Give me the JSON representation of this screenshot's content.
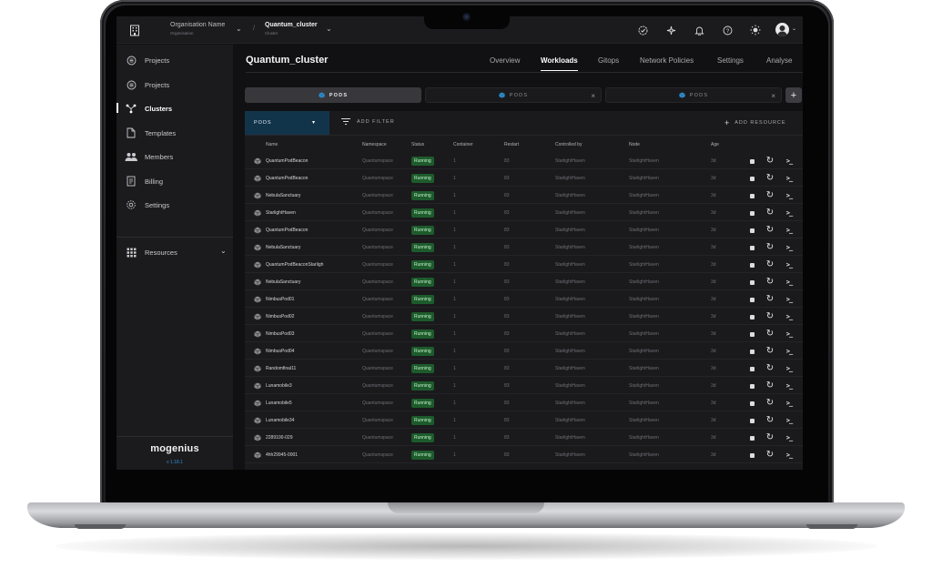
{
  "topbar": {
    "org_name": "Organisation Name",
    "org_sub": "Organisation",
    "separator": "/",
    "cluster_name": "Quantum_cluster",
    "cluster_sub": "Cluster"
  },
  "sidebar": {
    "items": [
      {
        "label": "Projects",
        "icon": "project-icon"
      },
      {
        "label": "Projects",
        "icon": "project-icon"
      },
      {
        "label": "Clusters",
        "icon": "cluster-icon",
        "active": true
      },
      {
        "label": "Templates",
        "icon": "document-icon"
      },
      {
        "label": "Members",
        "icon": "members-icon"
      },
      {
        "label": "Billing",
        "icon": "billing-icon"
      },
      {
        "label": "Settings",
        "icon": "gear-icon"
      },
      {
        "label": "Resources",
        "icon": "grid-icon"
      }
    ],
    "brand": "mogenius",
    "version": "v 1.18.1"
  },
  "main": {
    "title": "Quantum_cluster",
    "tabs": [
      "Overview",
      "Workloads",
      "Gitops",
      "Network Policies",
      "Settings",
      "Analyse"
    ],
    "active_tab": "Workloads",
    "pod_tabs": [
      "PODS",
      "PODS",
      "PODS"
    ],
    "type_select": "PODS",
    "add_filter": "ADD FILTER",
    "add_resource": "ADD RESOURCE"
  },
  "table": {
    "columns": [
      "Name",
      "Namespace",
      "Status",
      "Container",
      "Restart",
      "Controlled by",
      "Node",
      "Age"
    ],
    "rows": [
      [
        "QuantumPodBeacon",
        "Quantumspace",
        "Running",
        "1",
        "83",
        "StarlightHaven",
        "StarlightHaven",
        "3d"
      ],
      [
        "QuantumPodBeacon",
        "Quantumspace",
        "Running",
        "1",
        "83",
        "StarlightHaven",
        "StarlightHaven",
        "3d"
      ],
      [
        "NebulaSanctuary",
        "Quantumspace",
        "Running",
        "1",
        "83",
        "StarlightHaven",
        "StarlightHaven",
        "3d"
      ],
      [
        "StarlightHaven",
        "Quantumspace",
        "Running",
        "1",
        "83",
        "StarlightHaven",
        "StarlightHaven",
        "3d"
      ],
      [
        "QuantumPodBeacon",
        "Quantumspace",
        "Running",
        "1",
        "83",
        "StarlightHaven",
        "StarlightHaven",
        "3d"
      ],
      [
        "NebulaSanctuary",
        "Quantumspace",
        "Running",
        "1",
        "83",
        "StarlightHaven",
        "StarlightHaven",
        "3d"
      ],
      [
        "QuantumPodBeaconStarligh",
        "Quantumspace",
        "Running",
        "1",
        "83",
        "StarlightHaven",
        "StarlightHaven",
        "3d"
      ],
      [
        "NebulaSanctuary",
        "Quantumspace",
        "Running",
        "1",
        "83",
        "StarlightHaven",
        "StarlightHaven",
        "3d"
      ],
      [
        "NimbusPod01",
        "Quantumspace",
        "Running",
        "1",
        "83",
        "StarlightHaven",
        "StarlightHaven",
        "3d"
      ],
      [
        "NimbusPod02",
        "Quantumspace",
        "Running",
        "1",
        "83",
        "StarlightHaven",
        "StarlightHaven",
        "3d"
      ],
      [
        "NimbusPod03",
        "Quantumspace",
        "Running",
        "1",
        "83",
        "StarlightHaven",
        "StarlightHaven",
        "3d"
      ],
      [
        "NimbusPod04",
        "Quantumspace",
        "Running",
        "1",
        "83",
        "StarlightHaven",
        "StarlightHaven",
        "3d"
      ],
      [
        "Randomfinal11",
        "Quantumspace",
        "Running",
        "1",
        "83",
        "StarlightHaven",
        "StarlightHaven",
        "3d"
      ],
      [
        "Lunamobile3",
        "Quantumspace",
        "Running",
        "1",
        "83",
        "StarlightHaven",
        "StarlightHaven",
        "3d"
      ],
      [
        "Lunamobile5",
        "Quantumspace",
        "Running",
        "1",
        "83",
        "StarlightHaven",
        "StarlightHaven",
        "3d"
      ],
      [
        "Lunamobile34",
        "Quantumspace",
        "Running",
        "1",
        "83",
        "StarlightHaven",
        "StarlightHaven",
        "3d"
      ],
      [
        "2289100-029",
        "Quantumspace",
        "Running",
        "1",
        "83",
        "StarlightHaven",
        "StarlightHaven",
        "3d"
      ],
      [
        "4hh29945-0001",
        "Quantumspace",
        "Running",
        "1",
        "83",
        "StarlightHaven",
        "StarlightHaven",
        "3d"
      ]
    ]
  },
  "colors": {
    "accent": "#12344a",
    "status_running": "#1e5b2c",
    "cube": "#2f8fd0"
  }
}
